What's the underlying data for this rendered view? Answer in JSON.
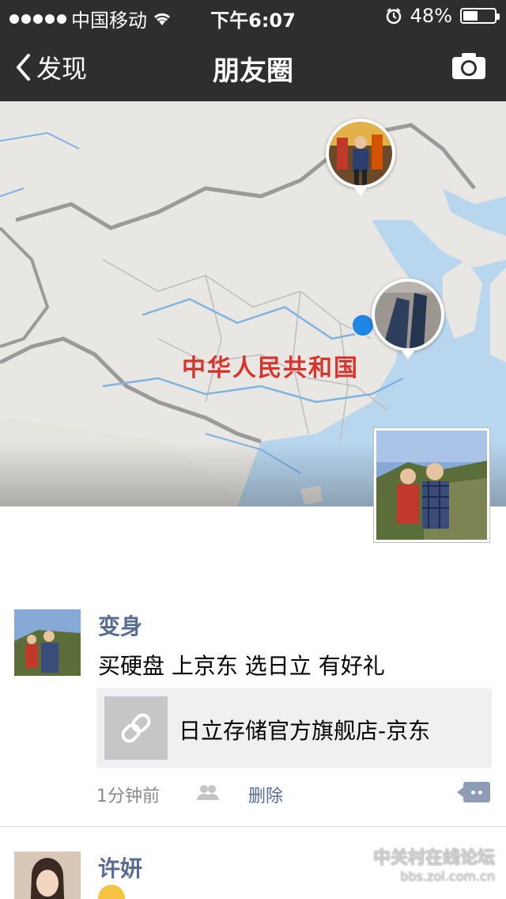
{
  "status_bar": {
    "carrier": "中国移动",
    "time": "下午6:07",
    "battery_percent": "48%",
    "battery_level": 0.48,
    "signal_icon": "signal-dots-icon",
    "wifi_icon": "wifi-icon",
    "alarm_icon": "alarm-icon"
  },
  "nav": {
    "back_label": "发现",
    "title": "朋友圈",
    "camera_icon": "camera-icon"
  },
  "map": {
    "country_label": "中华人民共和国",
    "username": "变身",
    "pins": [
      {
        "name": "photo-pin-north",
        "icon": "photo-pin"
      },
      {
        "name": "photo-pin-east",
        "icon": "photo-pin"
      }
    ],
    "dot_colors": {
      "blue": "#1f86e6",
      "orange": "#f58a1f"
    }
  },
  "posts": [
    {
      "author": "变身",
      "text": "买硬盘 上京东 选日立 有好礼",
      "link_title": "日立存储官方旗舰店-京东",
      "link_icon": "link-icon",
      "time": "1分钟前",
      "visibility_icon": "friends-icon",
      "delete_label": "删除",
      "comment_icon": "comment-icon"
    },
    {
      "author": "许妍",
      "emoji_icon": "smiley-icon"
    }
  ],
  "watermark": {
    "title": "中关村在线论坛",
    "url": "bbs.zol.com.cn"
  },
  "colors": {
    "nav_bg": "#2e2e2e",
    "name_blue": "#576b95",
    "map_label_red": "#d9342b"
  }
}
